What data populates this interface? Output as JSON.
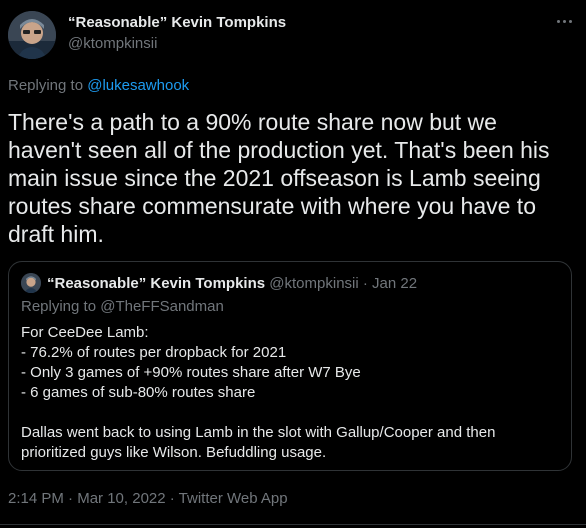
{
  "author": {
    "name": "“Reasonable” Kevin Tompkins",
    "handle": "@ktompkinsii"
  },
  "reply": {
    "prefix": "Replying to ",
    "mention": "@lukesawhook"
  },
  "tweet": {
    "text": "There's a path to a 90% route share now but we haven't seen all of the production yet. That's been his main issue since the 2021 offseason is Lamb seeing routes share commensurate with where you have to draft him."
  },
  "quote": {
    "name": "“Reasonable” Kevin Tompkins",
    "handle": "@ktompkinsii",
    "separator": " · ",
    "date": "Jan 22",
    "replying_to": "Replying to @TheFFSandman",
    "lines": [
      "For CeeDee Lamb:",
      "- 76.2% of routes per dropback for 2021",
      "- Only 3 games of +90% routes share after W7 Bye",
      "- 6 games of sub-80% routes share",
      "",
      "Dallas went back to using Lamb in the slot with Gallup/Cooper and then",
      "prioritized guys like Wilson. Befuddling usage."
    ]
  },
  "meta": {
    "time": "2:14 PM",
    "separator": " · ",
    "date": "Mar 10, 2022",
    "source": "Twitter Web App"
  },
  "icons": {
    "more": "more-horizontal-icon"
  },
  "colors": {
    "background": "#000000",
    "text": "#e7e9ea",
    "secondary": "#71767b",
    "link": "#1d9bf0",
    "border": "#2f3336"
  }
}
